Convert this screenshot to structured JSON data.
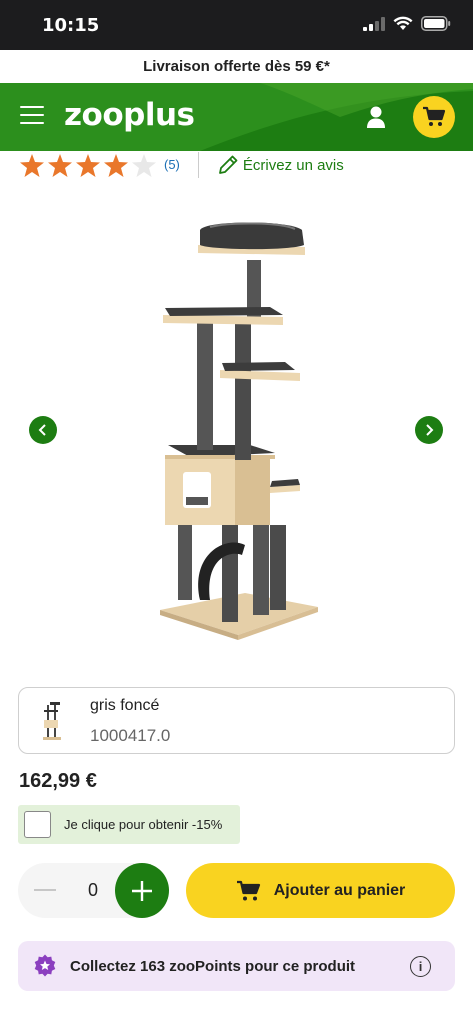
{
  "status_bar": {
    "time": "10:15"
  },
  "promo_banner": {
    "text": "Livraison offerte dès 59 €*"
  },
  "header": {
    "logo": "zooplus"
  },
  "rating": {
    "stars_filled": 4,
    "stars_total": 5,
    "review_count": "(5)",
    "write_review_label": "Écrivez un avis"
  },
  "gallery": {
    "prev_icon": "chevron-left-icon",
    "next_icon": "chevron-right-icon"
  },
  "variant": {
    "name": "gris foncé",
    "sku": "1000417.0"
  },
  "price": "162,99 €",
  "coupon": {
    "label": "Je clique pour obtenir -15%",
    "checked": false
  },
  "quantity": {
    "value": "0"
  },
  "add_to_cart": {
    "label": "Ajouter au panier"
  },
  "zoopoints": {
    "text": "Collectez 163 zooPoints pour ce produit",
    "info_icon": "i"
  },
  "colors": {
    "brand_green": "#1d7d12",
    "accent_yellow": "#f9d320",
    "points_bg": "#f1e6f8",
    "star_orange": "#e9772b"
  }
}
